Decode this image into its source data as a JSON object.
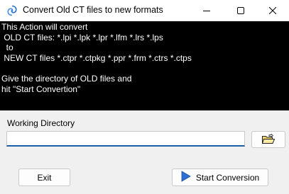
{
  "window": {
    "title": "Convert Old CT files to new formats",
    "icon": "spiral-logo-icon"
  },
  "info": {
    "lines": [
      "This Action will convert",
      " OLD CT files: *.lpi *.lpk *.lpr *.lfm *.lrs *.lps",
      "  to",
      " NEW CT files *.ctpr *.ctpkg *.ppr *.frm *.ctrs *.ctps",
      "",
      "Give the directory of OLD files and",
      "hit \"Start Convertion\""
    ]
  },
  "working_directory": {
    "label": "Working Directory",
    "value": "",
    "browse_icon": "open-folder-icon"
  },
  "buttons": {
    "exit": "Exit",
    "start": "Start Conversion"
  },
  "colors": {
    "info_background": "#000000",
    "info_text": "#ffffff",
    "accent": "#1b5ea8"
  }
}
